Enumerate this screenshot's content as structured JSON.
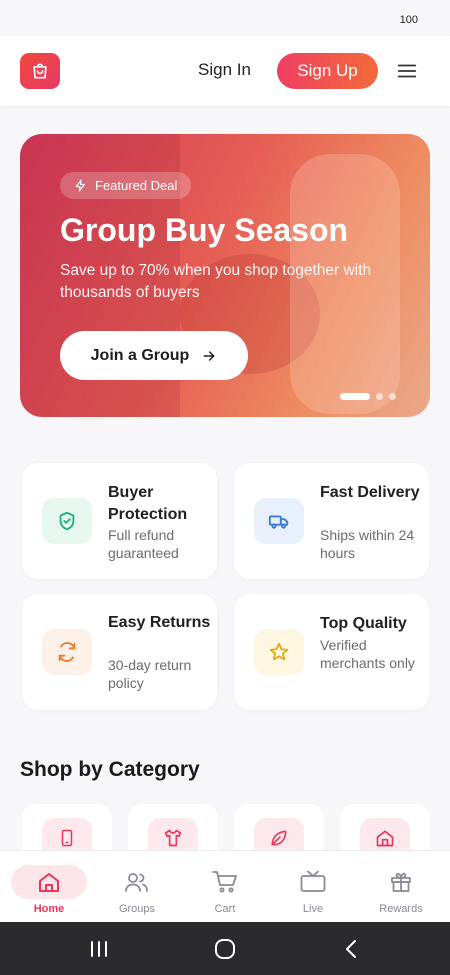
{
  "status_bar": {
    "battery": "100"
  },
  "header": {
    "sign_in": "Sign In",
    "sign_up": "Sign Up"
  },
  "hero": {
    "badge": "Featured Deal",
    "title": "Group Buy Season",
    "subtitle": "Save up to 70% when you shop together with thousands of buyers",
    "cta": "Join a Group",
    "slides": 3,
    "active_slide": 1
  },
  "features": [
    {
      "title": "Buyer Protection",
      "desc": "Full refund guaranteed",
      "icon": "shield-check-icon",
      "color": "#22b07d",
      "bg": "#e6f7ef"
    },
    {
      "title": "Fast Delivery",
      "desc": "Ships within 24 hours",
      "icon": "truck-icon",
      "color": "#3b7bd8",
      "bg": "#e8f0fb"
    },
    {
      "title": "Easy Returns",
      "desc": "30-day return policy",
      "icon": "refresh-icon",
      "color": "#f07a2a",
      "bg": "#fdf0e6"
    },
    {
      "title": "Top Quality",
      "desc": "Verified merchants only",
      "icon": "star-icon",
      "color": "#e6a817",
      "bg": "#fdf6e0"
    }
  ],
  "categories_section": {
    "title": "Shop by Category"
  },
  "categories": [
    {
      "icon": "smartphone-icon"
    },
    {
      "icon": "tshirt-icon"
    },
    {
      "icon": "leaf-icon"
    },
    {
      "icon": "home-icon"
    }
  ],
  "bottom_nav": [
    {
      "label": "Home",
      "icon": "home-icon",
      "active": true
    },
    {
      "label": "Groups",
      "icon": "users-icon",
      "active": false
    },
    {
      "label": "Cart",
      "icon": "cart-icon",
      "active": false
    },
    {
      "label": "Live",
      "icon": "tv-icon",
      "active": false
    },
    {
      "label": "Rewards",
      "icon": "gift-icon",
      "active": false
    }
  ],
  "colors": {
    "brand": "#e8375a",
    "accent": "#f26b3a"
  }
}
